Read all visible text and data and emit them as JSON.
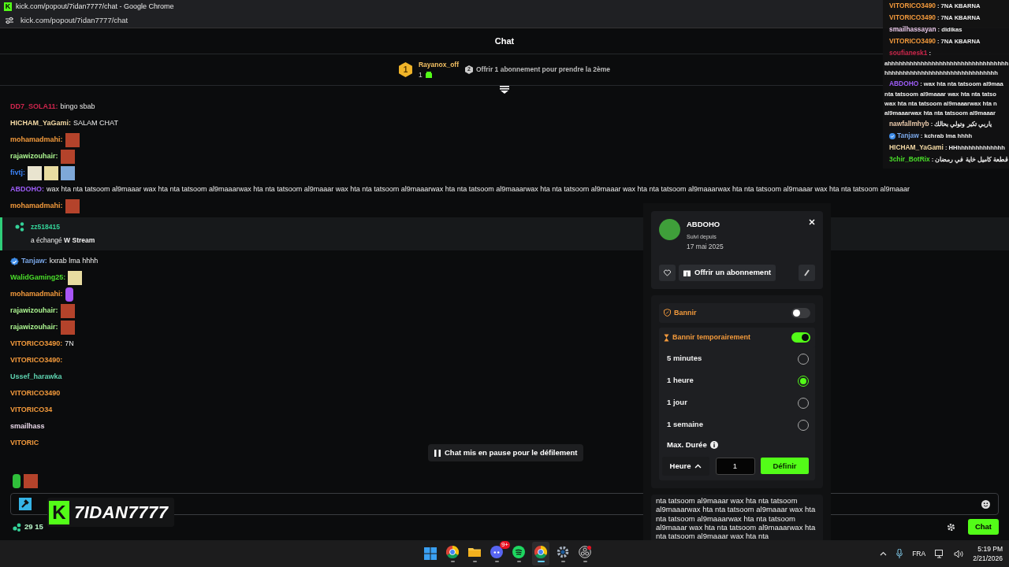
{
  "browser": {
    "favicon": "K",
    "title": "kick.com/popout/7idan7777/chat - Google Chrome",
    "url": "kick.com/popout/7idan7777/chat"
  },
  "chat_header": {
    "title": "Chat"
  },
  "pinned": {
    "rank": "1",
    "name": "Rayanox_off",
    "count": "1",
    "next_rank": "2",
    "text": "Offrir 1 abonnement pour prendre la 2ème"
  },
  "messages": [
    {
      "kind": "message",
      "name": "DD7_SOLA11:",
      "color": "#d0264e",
      "text": "bingo sbab"
    },
    {
      "kind": "message",
      "name": "HICHAM_YaGami:",
      "color": "#f3d9a4",
      "text": "SALAM CHAT"
    },
    {
      "kind": "message",
      "name": "mohamadmahi:",
      "color": "#f39a3c",
      "emotes": [
        {
          "kind": "face"
        }
      ]
    },
    {
      "kind": "message",
      "name": "rajawizouhair:",
      "color": "#a9f28e",
      "emotes": [
        {
          "kind": "face"
        }
      ]
    },
    {
      "kind": "message",
      "name": "fivtj:",
      "color": "#3b82f6",
      "emotes": [
        {
          "kind": "pack"
        },
        {
          "kind": "box"
        },
        {
          "kind": "card"
        }
      ]
    },
    {
      "kind": "message",
      "name": "ABDOHO:",
      "color": "#9d5cf7",
      "text": "wax hta nta tatsoom al9maaar wax hta nta tatsoom al9maaarwax hta nta tatsoom al9maaar wax hta nta tatsoom al9maaarwax hta nta tatsoom al9maaarwax hta nta tatsoom al9maaar wax hta nta tatsoom al9maaarwax hta nta tatsoom al9maaar wax hta nta tatsoom al9maaar"
    },
    {
      "kind": "message",
      "name": "mohamadmahi:",
      "color": "#f39a3c",
      "emotes": [
        {
          "kind": "face"
        }
      ]
    },
    {
      "kind": "event",
      "name": "zz518415",
      "color": "#34d399",
      "text": "a échangé **W Stream**"
    },
    {
      "kind": "message",
      "name": "Tanjaw:",
      "color": "#7aa7e8",
      "verified": true,
      "text": "kxrab lma hhhh"
    },
    {
      "kind": "message",
      "name": "WalidGaming25:",
      "color": "#4ade2a",
      "emotes": [
        {
          "kind": "box"
        }
      ]
    },
    {
      "kind": "message",
      "name": "mohamadmahi:",
      "color": "#f39a3c",
      "emotes": [
        {
          "kind": "hand"
        }
      ]
    },
    {
      "kind": "message",
      "name": "rajawizouhair:",
      "color": "#a9f28e",
      "emotes": [
        {
          "kind": "face"
        }
      ]
    },
    {
      "kind": "message",
      "name": "rajawizouhair:",
      "color": "#a9f28e",
      "emotes": [
        {
          "kind": "face"
        }
      ]
    },
    {
      "kind": "message",
      "name": "VITORICO3490:",
      "color": "#f39a3c",
      "text": "7N"
    },
    {
      "kind": "message",
      "name": "VITORICO3490:",
      "color": "#f39a3c"
    },
    {
      "kind": "message",
      "name": "Ussef_harawka",
      "color": "#5ed3b0"
    },
    {
      "kind": "message",
      "name": "VITORICO3490",
      "color": "#f39a3c"
    },
    {
      "kind": "message",
      "name": "VITORICO34",
      "color": "#f39a3c"
    },
    {
      "kind": "message",
      "name": "smailhass",
      "color": "#e6d6e6"
    },
    {
      "kind": "message",
      "name": "VITORIC",
      "color": "#f39a3c"
    }
  ],
  "pause_button": {
    "label": "Chat mis en pause pour le défilement"
  },
  "emote_bar": [
    {
      "kind": "hand"
    },
    {
      "kind": "face"
    }
  ],
  "footer": {
    "points": "29 15",
    "send_label": "Chat"
  },
  "stream_logo": {
    "letter": "K",
    "text": "7IDAN7777"
  },
  "stream_overlay": [
    {
      "name": "VITORICO3490",
      "color": "#f39a3c",
      "text": ": 7NA KBARNA"
    },
    {
      "name": "VITORICO3490",
      "color": "#f39a3c",
      "text": ": 7NA KBARNA"
    },
    {
      "name": "smailhassayan",
      "color": "#e6c6e6",
      "text": ": didikas"
    },
    {
      "name": "VITORICO3490",
      "color": "#f39a3c",
      "text": ": 7NA KBARNA"
    },
    {
      "name": "soufianesk1",
      "color": "#c8264a",
      "text": ":",
      "lines": [
        "ahhhhhhhhhhhhhhhhhhhhhhhhhhhhhhhhh",
        "hhhhhhhhhhhhhhhhhhhhhhhhhhhhhhh"
      ]
    },
    {
      "name": "ABDOHO",
      "color": "#9d5cf7",
      "text": ": wax hta nta tatsoom al9maa",
      "lines": [
        "nta tatsoom al9maaar wax hta nta tatso",
        "wax hta nta tatsoom al9maaarwax hta n",
        "al9maaarwax hta nta tatsoom al9maaar"
      ]
    },
    {
      "name": "nawfallmhyb",
      "color": "#e6c6a8",
      "text": ": ياربي تكبر وتولي بحالك"
    },
    {
      "name": "Tanjaw",
      "color": "#7aa7e8",
      "verified": true,
      "text": ": kchrab lma hhhh"
    },
    {
      "name": "HICHAM_YaGami",
      "color": "#f3d9a4",
      "text": ": HHhhhhhhhhhhhhh"
    },
    {
      "name": "3chir_BotRix",
      "color": "#4ade2a",
      "text": ": قطعة كاميل خاية في رمضان"
    }
  ],
  "user_card": {
    "name": "ABDOHO",
    "followed_label": "Suivi depuis",
    "followed_date": "17 mai 2025",
    "gift_label": "Offrir un abonnement",
    "ban": {
      "label": "Bannir",
      "on": false
    },
    "timeout": {
      "label": "Bannir temporairement",
      "on": true,
      "options": [
        {
          "label": "5 minutes",
          "selected": false
        },
        {
          "label": "1 heure",
          "selected": true
        },
        {
          "label": "1 jour",
          "selected": false
        },
        {
          "label": "1 semaine",
          "selected": false
        }
      ]
    },
    "max_label": "Max. Durée",
    "unit": "Heure",
    "amount": "1",
    "set_label": "Définir",
    "message": "nta tatsoom al9maaar wax hta nta tatsoom al9maaarwax hta nta tatsoom al9maaar wax hta nta tatsoom al9maaarwax hta nta tatsoom al9maaar wax hta nta tatsoom al9maaarwax hta nta tatsoom al9maaar wax hta nta"
  },
  "taskbar": {
    "apps": [
      {
        "kind": "start",
        "selected": false
      },
      {
        "kind": "browser",
        "selected": false
      },
      {
        "kind": "folder",
        "selected": false
      },
      {
        "kind": "chat",
        "selected": false,
        "badge": "9+"
      },
      {
        "kind": "music",
        "selected": false
      },
      {
        "kind": "browser",
        "selected": true
      },
      {
        "kind": "gear",
        "selected": false
      },
      {
        "kind": "record",
        "selected": false
      }
    ],
    "language": "FRA",
    "time": "5:19 PM",
    "date": "2/21/2026"
  }
}
